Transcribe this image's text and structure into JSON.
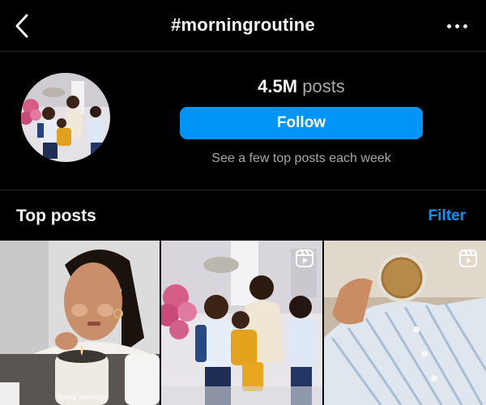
{
  "header": {
    "title": "#morningroutine",
    "back_icon": "chevron-left-icon",
    "more_icon": "more-horizontal-icon"
  },
  "hashtag": {
    "post_count": "4.5M",
    "post_count_label": "posts",
    "follow_label": "Follow",
    "subtext": "See a few top posts each week"
  },
  "top_posts": {
    "title": "Top posts",
    "filter_label": "Filter",
    "posts": [
      {
        "caption": "Spring mornings",
        "is_reel": false
      },
      {
        "caption": "",
        "is_reel": true
      },
      {
        "caption": "",
        "is_reel": true
      }
    ]
  },
  "colors": {
    "background": "#000000",
    "accent": "#0095f6",
    "text_primary": "#f5f5f5",
    "text_secondary": "#a8a8a8",
    "divider": "#262626"
  }
}
